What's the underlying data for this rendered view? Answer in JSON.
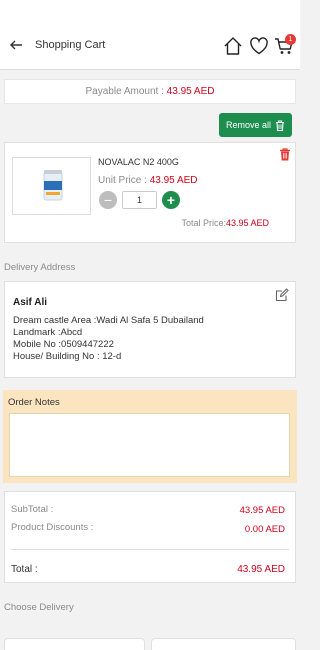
{
  "header": {
    "title": "Shopping Cart",
    "cart_count": "1"
  },
  "payable": {
    "label": "Payable Amount : ",
    "amount": "43.95 AED"
  },
  "actions": {
    "remove_all_label": "Remove all"
  },
  "cart_items": [
    {
      "name": "NOVALAC N2 400G",
      "unit_price_label": "Unit Price : ",
      "unit_price": "43.95 AED",
      "quantity": "1",
      "total_price_label": "Total Price:",
      "total_price": "43.95 AED"
    }
  ],
  "delivery_address": {
    "section_label": "Delivery Address",
    "name": "Asif Ali",
    "area": "Dream castle Area :Wadi Al Safa 5 Dubailand",
    "landmark": "Landmark :Abcd",
    "mobile": "Mobile No :0509447222",
    "house": "House/ Building No : 12-d"
  },
  "order_notes": {
    "title": "Order Notes",
    "value": ""
  },
  "totals": {
    "subtotal_label": "SubTotal :",
    "subtotal_value": "43.95 AED",
    "discount_label": "Product Discounts :",
    "discount_value": "0.00 AED",
    "total_label": "Total :",
    "total_value": "43.95 AED"
  },
  "delivery": {
    "section_label": "Choose Delivery"
  },
  "colors": {
    "accent_green": "#1e8e4e",
    "price_red": "#d0021b",
    "notes_bg": "#fbe5c1"
  }
}
